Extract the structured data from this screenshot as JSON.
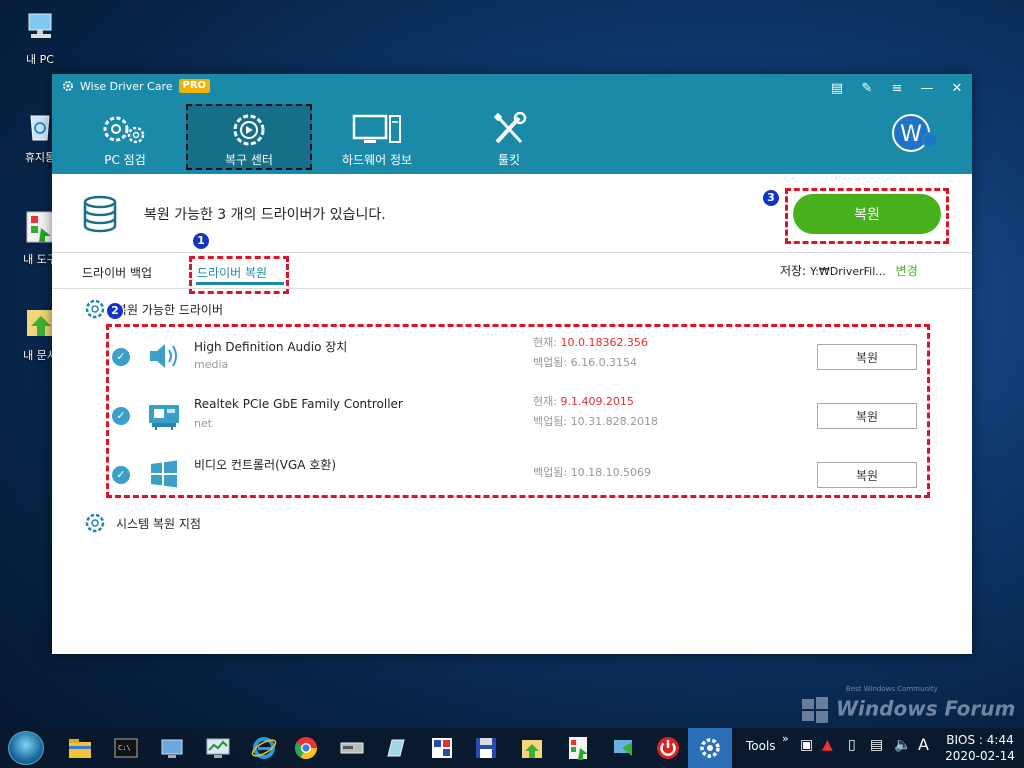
{
  "desktop": {
    "icons": [
      {
        "label": "내 PC",
        "icon": "pc-icon"
      },
      {
        "label": "휴지통",
        "icon": "recycle-bin-icon"
      },
      {
        "label": "내 도구",
        "icon": "folder-tools-icon"
      },
      {
        "label": "내 문서",
        "icon": "folder-docs-icon"
      }
    ],
    "watermark": "Windows Forum",
    "watermark_small": "Best Windows Community"
  },
  "app": {
    "title": "Wise Driver Care",
    "badge": "PRO",
    "nav": [
      {
        "label": "PC 점검",
        "icon": "gears-icon"
      },
      {
        "label": "복구 센터",
        "icon": "restore-gear-icon",
        "active": true
      },
      {
        "label": "하드웨어 정보",
        "icon": "monitor-icon"
      },
      {
        "label": "툴킷",
        "icon": "tools-icon"
      }
    ],
    "avatar_letter": "W",
    "summary": "복원 가능한 3 개의 드라이버가 있습니다.",
    "restore_button": "복원",
    "subtabs": [
      {
        "label": "드라이버 백업"
      },
      {
        "label": "드라이버 복원",
        "active": true
      }
    ],
    "storage_label": "저장:",
    "storage_path": "Y:₩DriverFil...",
    "storage_change": "변경",
    "section_restorable": "복원 가능한 드라이버",
    "section_system": "시스템 복원 지점",
    "drivers": [
      {
        "name": "High Definition Audio 장치",
        "type": "media",
        "current_label": "현재:",
        "current": "10.0.18362.356",
        "backup_label": "백업됨:",
        "backup": "6.16.0.3154",
        "button": "복원",
        "icon": "speaker-icon"
      },
      {
        "name": "Realtek PCIe GbE Family Controller",
        "type": "net",
        "current_label": "현재:",
        "current": "9.1.409.2015",
        "backup_label": "백업됨:",
        "backup": "10.31.828.2018",
        "button": "복원",
        "icon": "network-card-icon"
      },
      {
        "name": "비디오 컨트롤러(VGA 호환)",
        "type": "",
        "current_label": "",
        "current": "",
        "backup_label": "백업됨:",
        "backup": "10.18.10.5069",
        "button": "복원",
        "icon": "windows-logo-icon"
      }
    ],
    "annotations": [
      "1",
      "2",
      "3"
    ]
  },
  "taskbar": {
    "tools_label": "Tools",
    "ime": "A",
    "clock_line1": "BIOS : 4:44",
    "clock_line2": "2020-02-14"
  },
  "colors": {
    "header": "#1b8aa8",
    "accent_green": "#47b21e",
    "highlight_red": "#e0122a",
    "version_red": "#e03030"
  }
}
